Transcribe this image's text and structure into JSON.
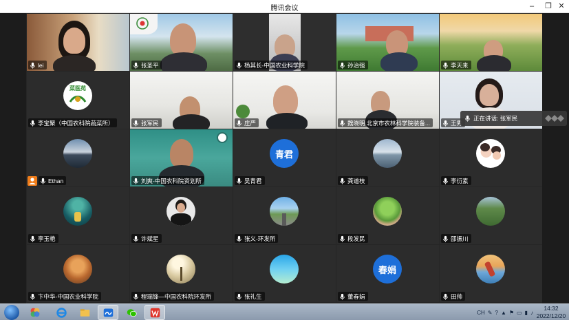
{
  "window": {
    "title": "腾讯会议",
    "controls": [
      "–",
      "❐",
      "✕"
    ]
  },
  "speaking": {
    "text": "正在讲话: 张军民"
  },
  "participants": [
    {
      "name": "lei"
    },
    {
      "name": "张圣平"
    },
    {
      "name": "杨其长-中国农业科学院"
    },
    {
      "name": "孙治强"
    },
    {
      "name": "李天来"
    },
    {
      "name": "李宝聚（中国农科院蔬菜所）"
    },
    {
      "name": "张军民"
    },
    {
      "name": "庄严"
    },
    {
      "name": "魏晓明 北京市农林科学院装备..."
    },
    {
      "name": "王秀"
    },
    {
      "name": "Ethan"
    },
    {
      "name": "刘爽-中国农科院资划所"
    },
    {
      "name": "吴青君",
      "avatar_text": "青君"
    },
    {
      "name": "龚道枝"
    },
    {
      "name": "李衍素"
    },
    {
      "name": "李玉艳"
    },
    {
      "name": "许斌星"
    },
    {
      "name": "张义-环发所"
    },
    {
      "name": "段发民"
    },
    {
      "name": "邵振川"
    },
    {
      "name": "卞中华-中国农业科学院"
    },
    {
      "name": "程瑞锋—中国农科院环发所"
    },
    {
      "name": "张礼生"
    },
    {
      "name": "董春娟",
      "avatar_text": "春娟"
    },
    {
      "name": "田帅"
    }
  ],
  "logo_texts": {
    "tile2": "",
    "tile6": "菜医苑"
  },
  "taskbar": {
    "tray_lang": "CH",
    "time": "14:32",
    "date": "2022/12/20"
  },
  "colors": {
    "accent": "#1e6fd9",
    "host_badge": "#f07d1a"
  }
}
